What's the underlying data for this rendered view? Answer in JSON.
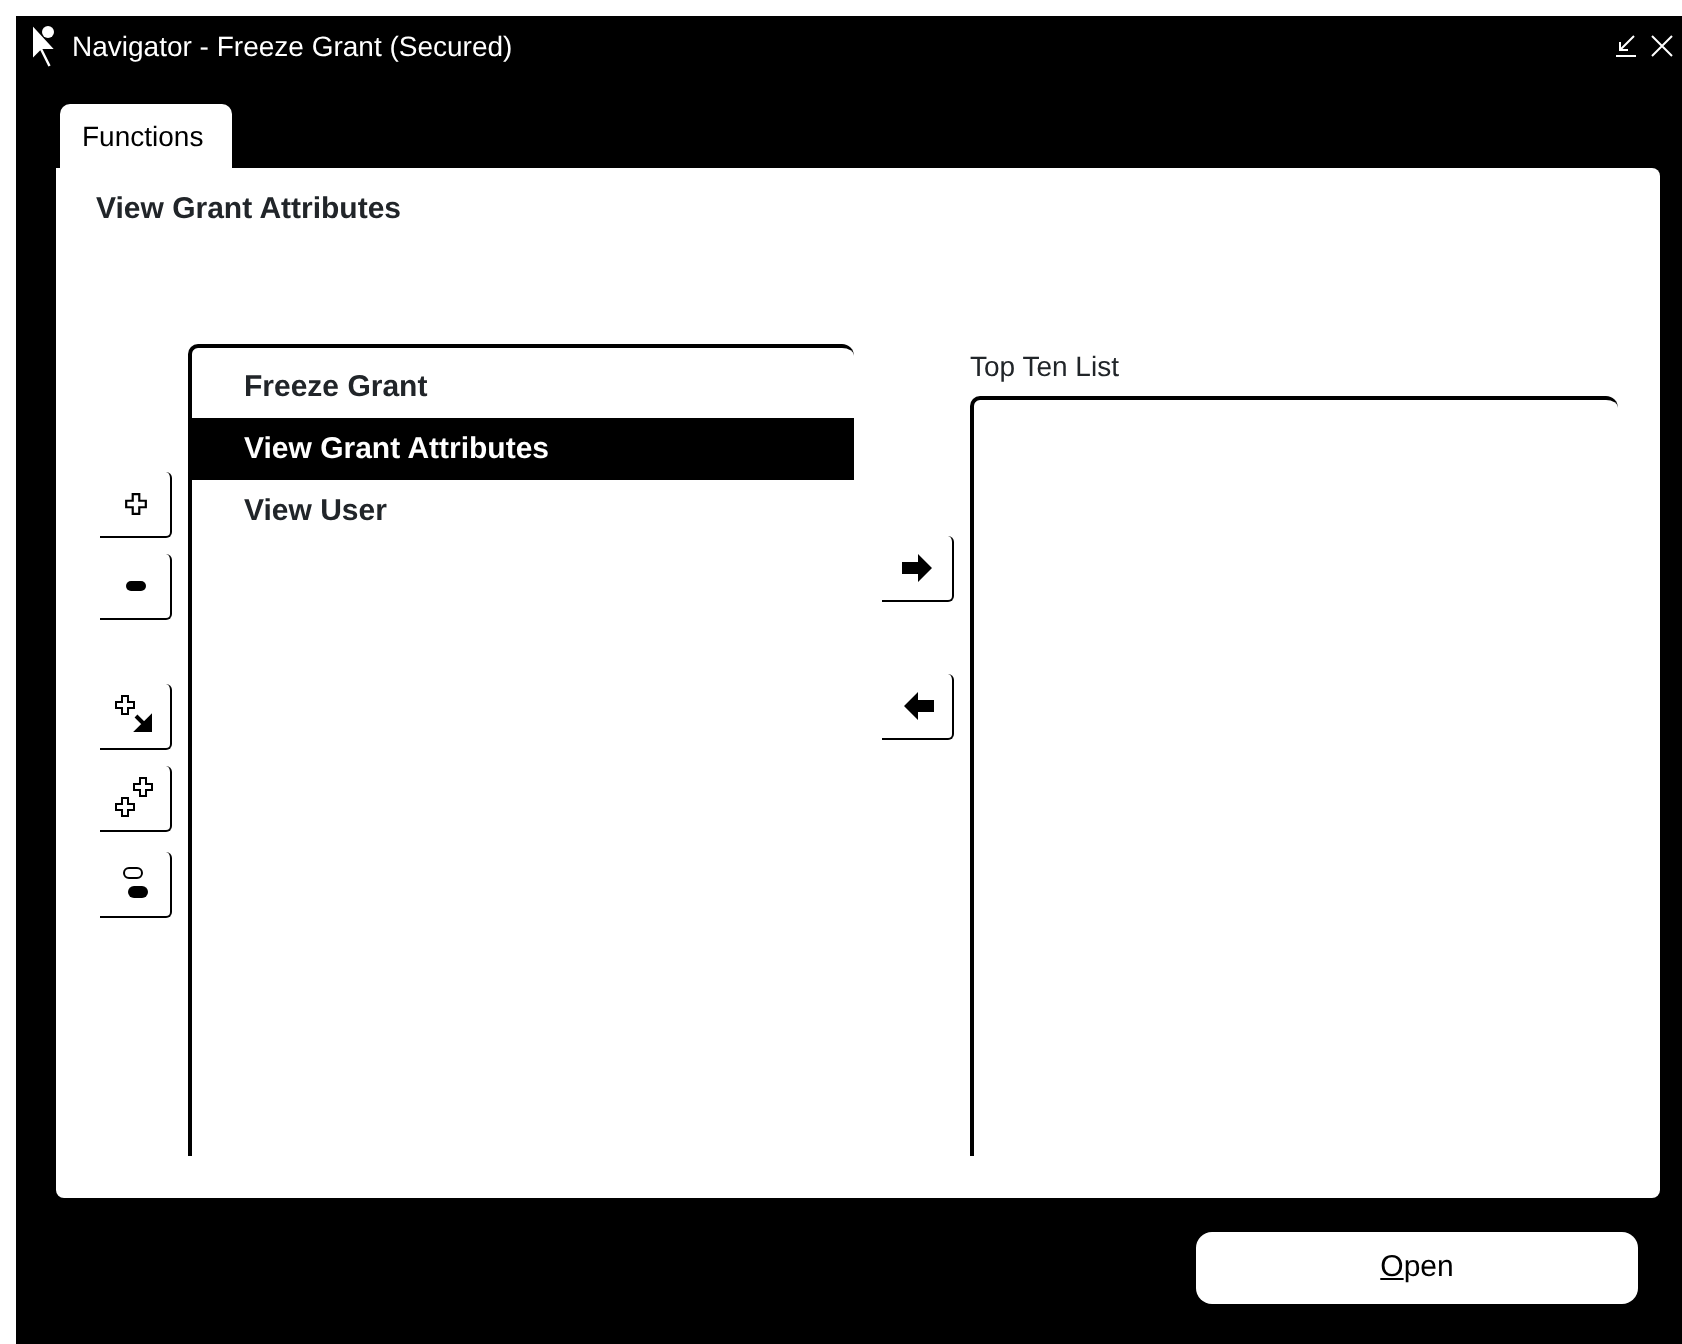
{
  "window": {
    "title": "Navigator - Freeze Grant (Secured)"
  },
  "tabs": [
    {
      "label": "Functions",
      "selected": true
    }
  ],
  "heading": "View Grant Attributes",
  "functions": [
    {
      "label": "Freeze Grant",
      "selected": false
    },
    {
      "label": "View Grant Attributes",
      "selected": true
    },
    {
      "label": "View User",
      "selected": false
    }
  ],
  "top_ten": {
    "label": "Top Ten List"
  },
  "buttons": [
    {
      "label": "Open",
      "first_letter_underlined": true
    }
  ]
}
